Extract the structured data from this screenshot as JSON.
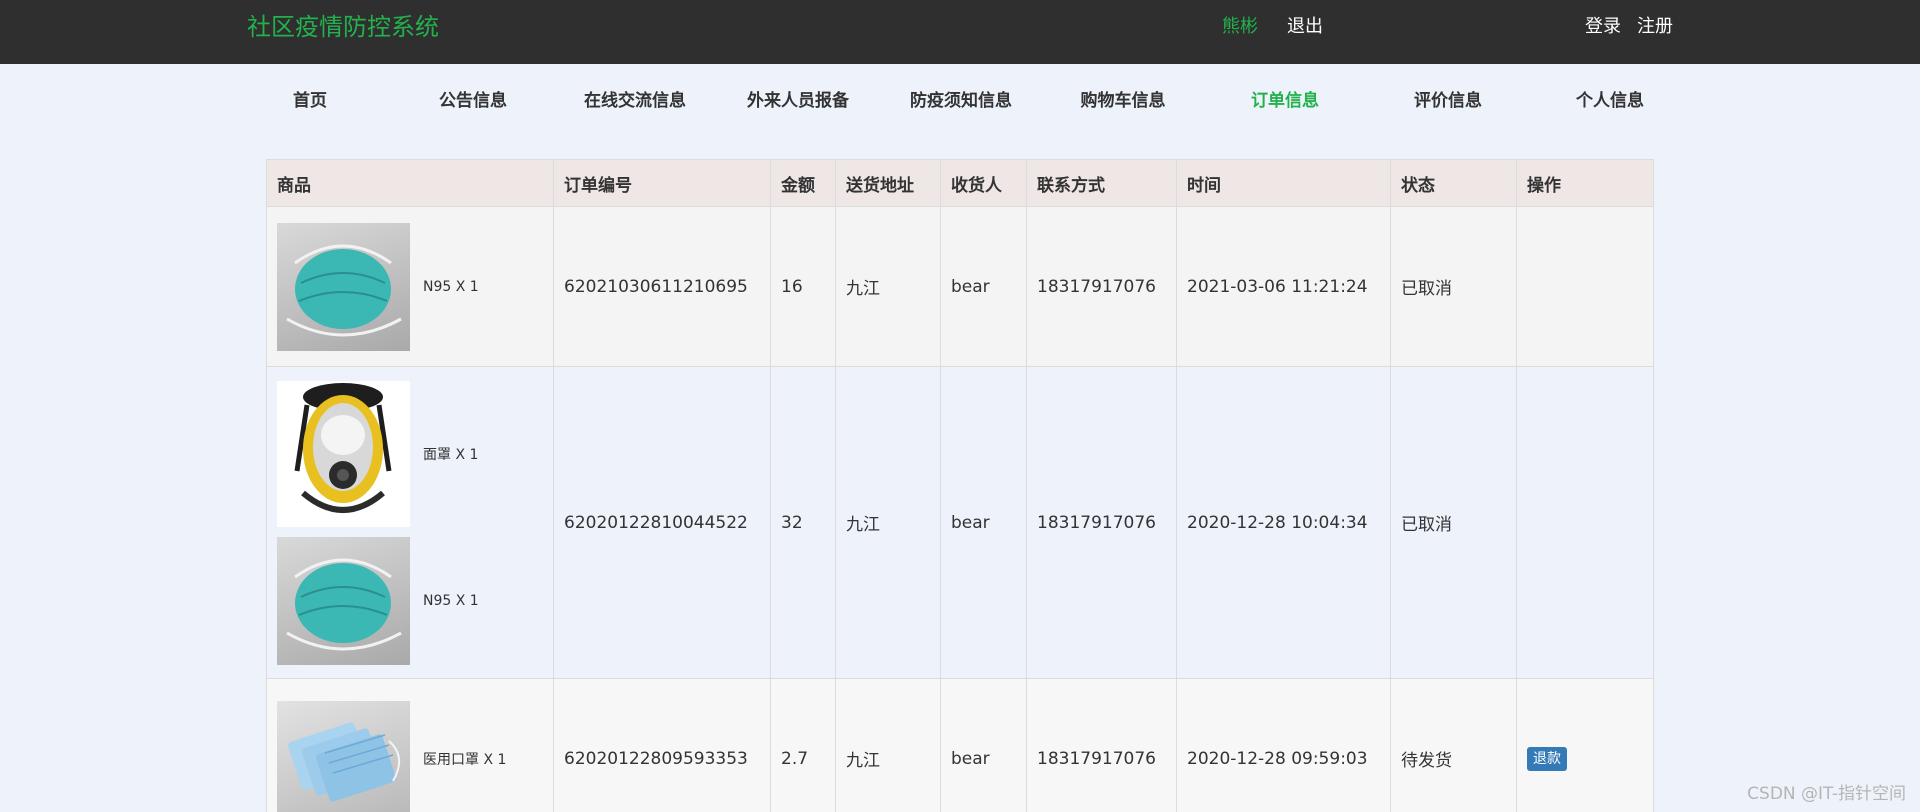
{
  "header": {
    "title": "社区疫情防控系统",
    "user_name": "熊彬",
    "logout": "退出",
    "login": "登录",
    "register": "注册",
    "accent_color": "#22b14c",
    "bar_color": "#2f2f2f"
  },
  "nav": [
    {
      "label": "首页"
    },
    {
      "label": "公告信息"
    },
    {
      "label": "在线交流信息"
    },
    {
      "label": "外来人员报备"
    },
    {
      "label": "防疫须知信息"
    },
    {
      "label": "购物车信息"
    },
    {
      "label": "订单信息",
      "active": true
    },
    {
      "label": "评价信息"
    },
    {
      "label": "个人信息"
    }
  ],
  "table": {
    "headers": [
      "商品",
      "订单编号",
      "金额",
      "送货地址",
      "收货人",
      "联系方式",
      "时间",
      "状态",
      "操作"
    ],
    "rows": [
      {
        "products": [
          {
            "image": "n95-mask-image",
            "label": "N95 X 1"
          }
        ],
        "order_no": "62021030611210695",
        "amount": "16",
        "address": "九江",
        "receiver": "bear",
        "phone": "18317917076",
        "time": "2021-03-06 11:21:24",
        "status": "已取消",
        "action": ""
      },
      {
        "products": [
          {
            "image": "face-mask-image",
            "label": "面罩 X 1"
          },
          {
            "image": "n95-mask-image",
            "label": "N95 X 1"
          }
        ],
        "order_no": "62020122810044522",
        "amount": "32",
        "address": "九江",
        "receiver": "bear",
        "phone": "18317917076",
        "time": "2020-12-28 10:04:34",
        "status": "已取消",
        "action": ""
      },
      {
        "products": [
          {
            "image": "surgical-mask-image",
            "label": "医用口罩 X 1"
          }
        ],
        "order_no": "62020122809593353",
        "amount": "2.7",
        "address": "九江",
        "receiver": "bear",
        "phone": "18317917076",
        "time": "2020-12-28 09:59:03",
        "status": "待发货",
        "action": "退款"
      }
    ]
  },
  "watermark": "CSDN @IT-指针空间"
}
